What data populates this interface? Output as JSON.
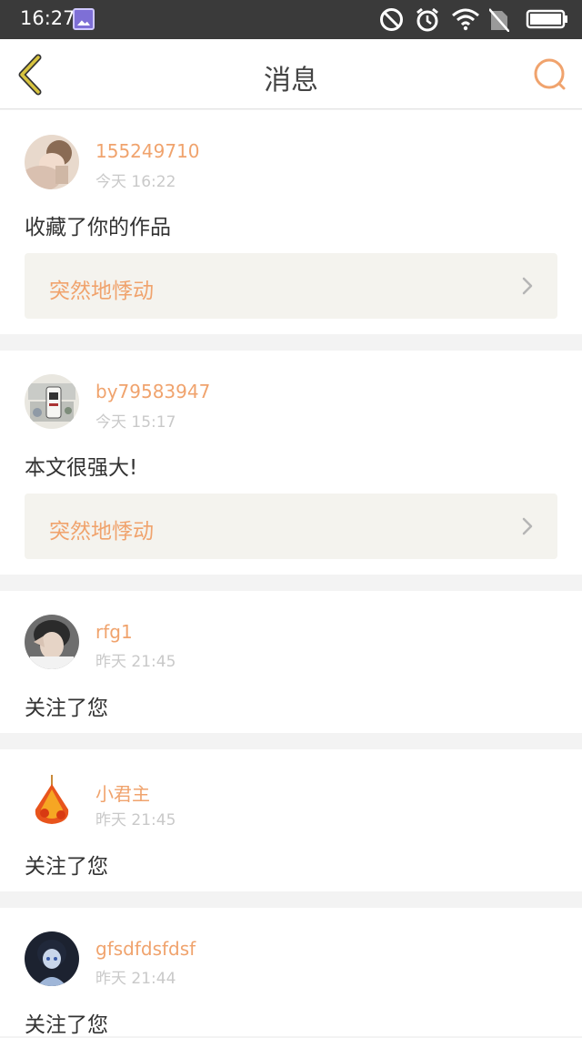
{
  "status_bar": {
    "time": "16:27",
    "icons": [
      "gallery-icon",
      "do-not-disturb-icon",
      "alarm-icon",
      "wifi-icon",
      "no-sim-icon",
      "battery-icon"
    ]
  },
  "header": {
    "title": "消息",
    "back_icon": "chevron-left-icon",
    "search_icon": "search-icon"
  },
  "colors": {
    "accent": "#f0a36d",
    "back_arrow": "#d8c440",
    "status_bar": "#3a3a3a",
    "link_background": "#f4f3ee",
    "timestamp": "#c9c9c9"
  },
  "messages": [
    {
      "username": "155249710",
      "time": "今天 16:22",
      "text": "收藏了你的作品",
      "link_text": "突然地悸动"
    },
    {
      "username": "by79583947",
      "time": "今天 15:17",
      "text": "本文很强大!",
      "link_text": "突然地悸动"
    },
    {
      "username": "rfg1",
      "time": "昨天 21:45",
      "text": "关注了您"
    },
    {
      "username": "小君主",
      "time": "昨天 21:45",
      "text": "关注了您"
    },
    {
      "username": "gfsdfdsfdsf",
      "time": "昨天 21:44",
      "text": "关注了您"
    }
  ]
}
